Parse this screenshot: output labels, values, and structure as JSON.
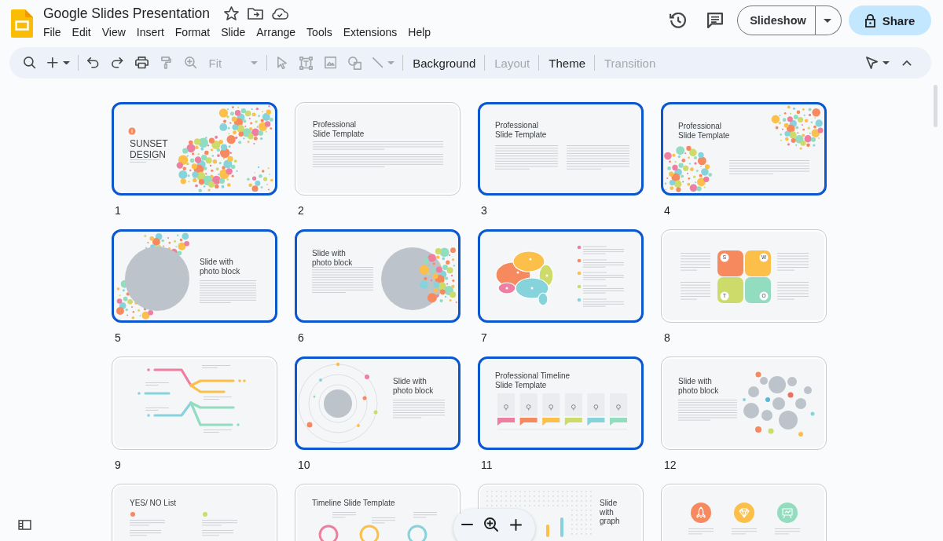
{
  "document": {
    "title": "Google Slides Presentation",
    "starred": false
  },
  "menu": [
    "File",
    "Edit",
    "View",
    "Insert",
    "Format",
    "Slide",
    "Arrange",
    "Tools",
    "Extensions",
    "Help"
  ],
  "header": {
    "slideshow_label": "Slideshow",
    "share_label": "Share"
  },
  "toolbar": {
    "tools_left": [
      {
        "kind": "search",
        "disabled": false
      },
      {
        "kind": "add",
        "disabled": false
      }
    ],
    "tools_edit": [
      {
        "kind": "undo",
        "disabled": false
      },
      {
        "kind": "redo",
        "disabled": false
      },
      {
        "kind": "print",
        "disabled": false
      },
      {
        "kind": "format",
        "disabled": true
      },
      {
        "kind": "zoom",
        "disabled": true
      }
    ],
    "zoom_select": {
      "value": "Fit",
      "disabled": true
    },
    "tools_insert": [
      {
        "kind": "select",
        "disabled": true
      },
      {
        "kind": "textbox",
        "disabled": true
      },
      {
        "kind": "image",
        "disabled": true
      },
      {
        "kind": "shape",
        "disabled": true
      },
      {
        "kind": "line",
        "disabled": true
      }
    ],
    "actions": [
      {
        "label": "Background",
        "disabled": false
      },
      {
        "label": "Layout",
        "disabled": true
      },
      {
        "label": "Theme",
        "disabled": false
      },
      {
        "label": "Transition",
        "disabled": true
      }
    ]
  },
  "slides": [
    {
      "number": "1",
      "selected": true,
      "kind": "cover",
      "title": "SUNSET\nDESIGN"
    },
    {
      "number": "2",
      "selected": false,
      "kind": "text",
      "title": "Professional\nSlide Template"
    },
    {
      "number": "3",
      "selected": true,
      "kind": "two-column",
      "title": "Professional\nSlide Template"
    },
    {
      "number": "4",
      "selected": true,
      "kind": "bubbles-text",
      "title": "Professional\nSlide Template"
    },
    {
      "number": "5",
      "selected": true,
      "kind": "photo-left",
      "title": "Slide with\nphoto block"
    },
    {
      "number": "6",
      "selected": true,
      "kind": "photo-right",
      "title": "Slide with\nphoto block"
    },
    {
      "number": "7",
      "selected": true,
      "kind": "brain"
    },
    {
      "number": "8",
      "selected": false,
      "kind": "swot",
      "letters": [
        "S",
        "W",
        "T",
        "O"
      ]
    },
    {
      "number": "9",
      "selected": false,
      "kind": "arrows"
    },
    {
      "number": "10",
      "selected": true,
      "kind": "orbit",
      "title": "Slide with\nphoto block"
    },
    {
      "number": "11",
      "selected": true,
      "kind": "timeline",
      "title": "Professional Timeline\nSlide Template"
    },
    {
      "number": "12",
      "selected": false,
      "kind": "photo-cluster",
      "title": "Slide with\nphoto block"
    },
    {
      "selected": false,
      "kind": "yes-no",
      "title": "YES/ NO List"
    },
    {
      "selected": false,
      "kind": "timeline-circles",
      "title": "Timeline Slide Template"
    },
    {
      "selected": false,
      "kind": "graph",
      "title": "Slide\nwith\ngraph"
    },
    {
      "selected": false,
      "kind": "icons"
    }
  ]
}
